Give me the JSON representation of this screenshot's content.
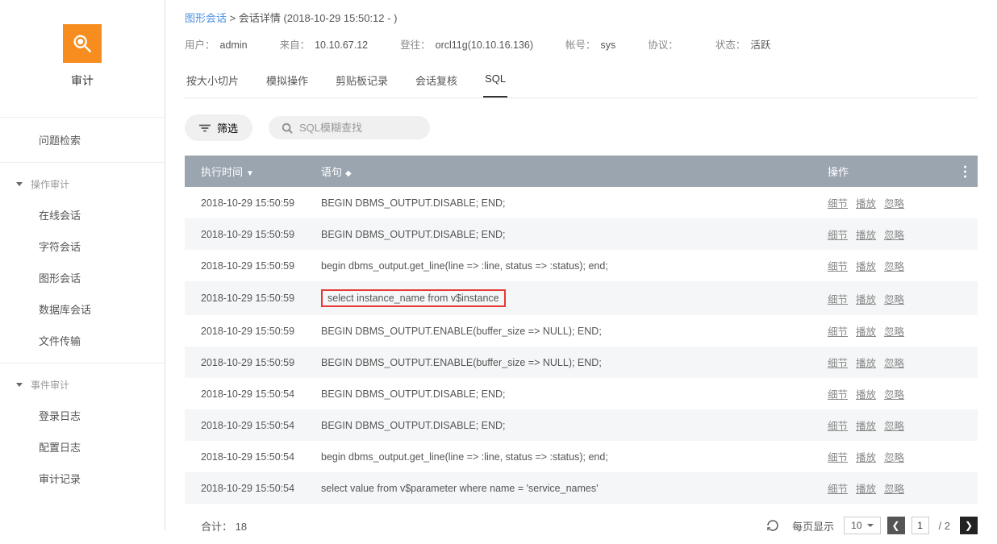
{
  "sidebar": {
    "title": "审计",
    "top_item": "问题检索",
    "group1": {
      "header": "操作审计",
      "items": [
        "在线会话",
        "字符会话",
        "图形会话",
        "数据库会话",
        "文件传输"
      ]
    },
    "group2": {
      "header": "事件审计",
      "items": [
        "登录日志",
        "配置日志",
        "审计记录"
      ]
    }
  },
  "breadcrumb": {
    "root": "图形会话",
    "sep": ">",
    "detail": "会话详情 (2018-10-29 15:50:12 - )"
  },
  "info": {
    "user_label": "用户：",
    "user": "admin",
    "from_label": "来自：",
    "from": "10.10.67.12",
    "login_label": "登往：",
    "login": "orcl11g(10.10.16.136)",
    "account_label": "帐号：",
    "account": "sys",
    "protocol_label": "协议：",
    "protocol": "",
    "status_label": "状态：",
    "status": "活跃"
  },
  "tabs": [
    "按大小切片",
    "模拟操作",
    "剪贴板记录",
    "会话复核",
    "SQL"
  ],
  "active_tab_index": 4,
  "toolbar": {
    "filter_label": "筛选",
    "search_placeholder": "SQL模糊查找"
  },
  "columns": {
    "time": "执行时间",
    "sql": "语句",
    "actions": "操作"
  },
  "action_labels": {
    "detail": "细节",
    "play": "播放",
    "ignore": "忽略"
  },
  "rows": [
    {
      "time": "2018-10-29 15:50:59",
      "sql": "BEGIN DBMS_OUTPUT.DISABLE; END;",
      "highlight": false
    },
    {
      "time": "2018-10-29 15:50:59",
      "sql": "BEGIN DBMS_OUTPUT.DISABLE; END;",
      "highlight": false
    },
    {
      "time": "2018-10-29 15:50:59",
      "sql": "begin dbms_output.get_line(line => :line, status => :status); end;",
      "highlight": false
    },
    {
      "time": "2018-10-29 15:50:59",
      "sql": "select instance_name from v$instance",
      "highlight": true
    },
    {
      "time": "2018-10-29 15:50:59",
      "sql": "BEGIN DBMS_OUTPUT.ENABLE(buffer_size => NULL); END;",
      "highlight": false
    },
    {
      "time": "2018-10-29 15:50:59",
      "sql": "BEGIN DBMS_OUTPUT.ENABLE(buffer_size => NULL); END;",
      "highlight": false
    },
    {
      "time": "2018-10-29 15:50:54",
      "sql": "BEGIN DBMS_OUTPUT.DISABLE; END;",
      "highlight": false
    },
    {
      "time": "2018-10-29 15:50:54",
      "sql": "BEGIN DBMS_OUTPUT.DISABLE; END;",
      "highlight": false
    },
    {
      "time": "2018-10-29 15:50:54",
      "sql": "begin dbms_output.get_line(line => :line, status => :status); end;",
      "highlight": false
    },
    {
      "time": "2018-10-29 15:50:54",
      "sql": "select value from v$parameter where name = 'service_names'",
      "highlight": false
    }
  ],
  "footer": {
    "total_label": "合计：",
    "total": "18",
    "page_size_label": "每页显示",
    "page_size": "10",
    "current_page": "1",
    "page_total": "/ 2"
  }
}
